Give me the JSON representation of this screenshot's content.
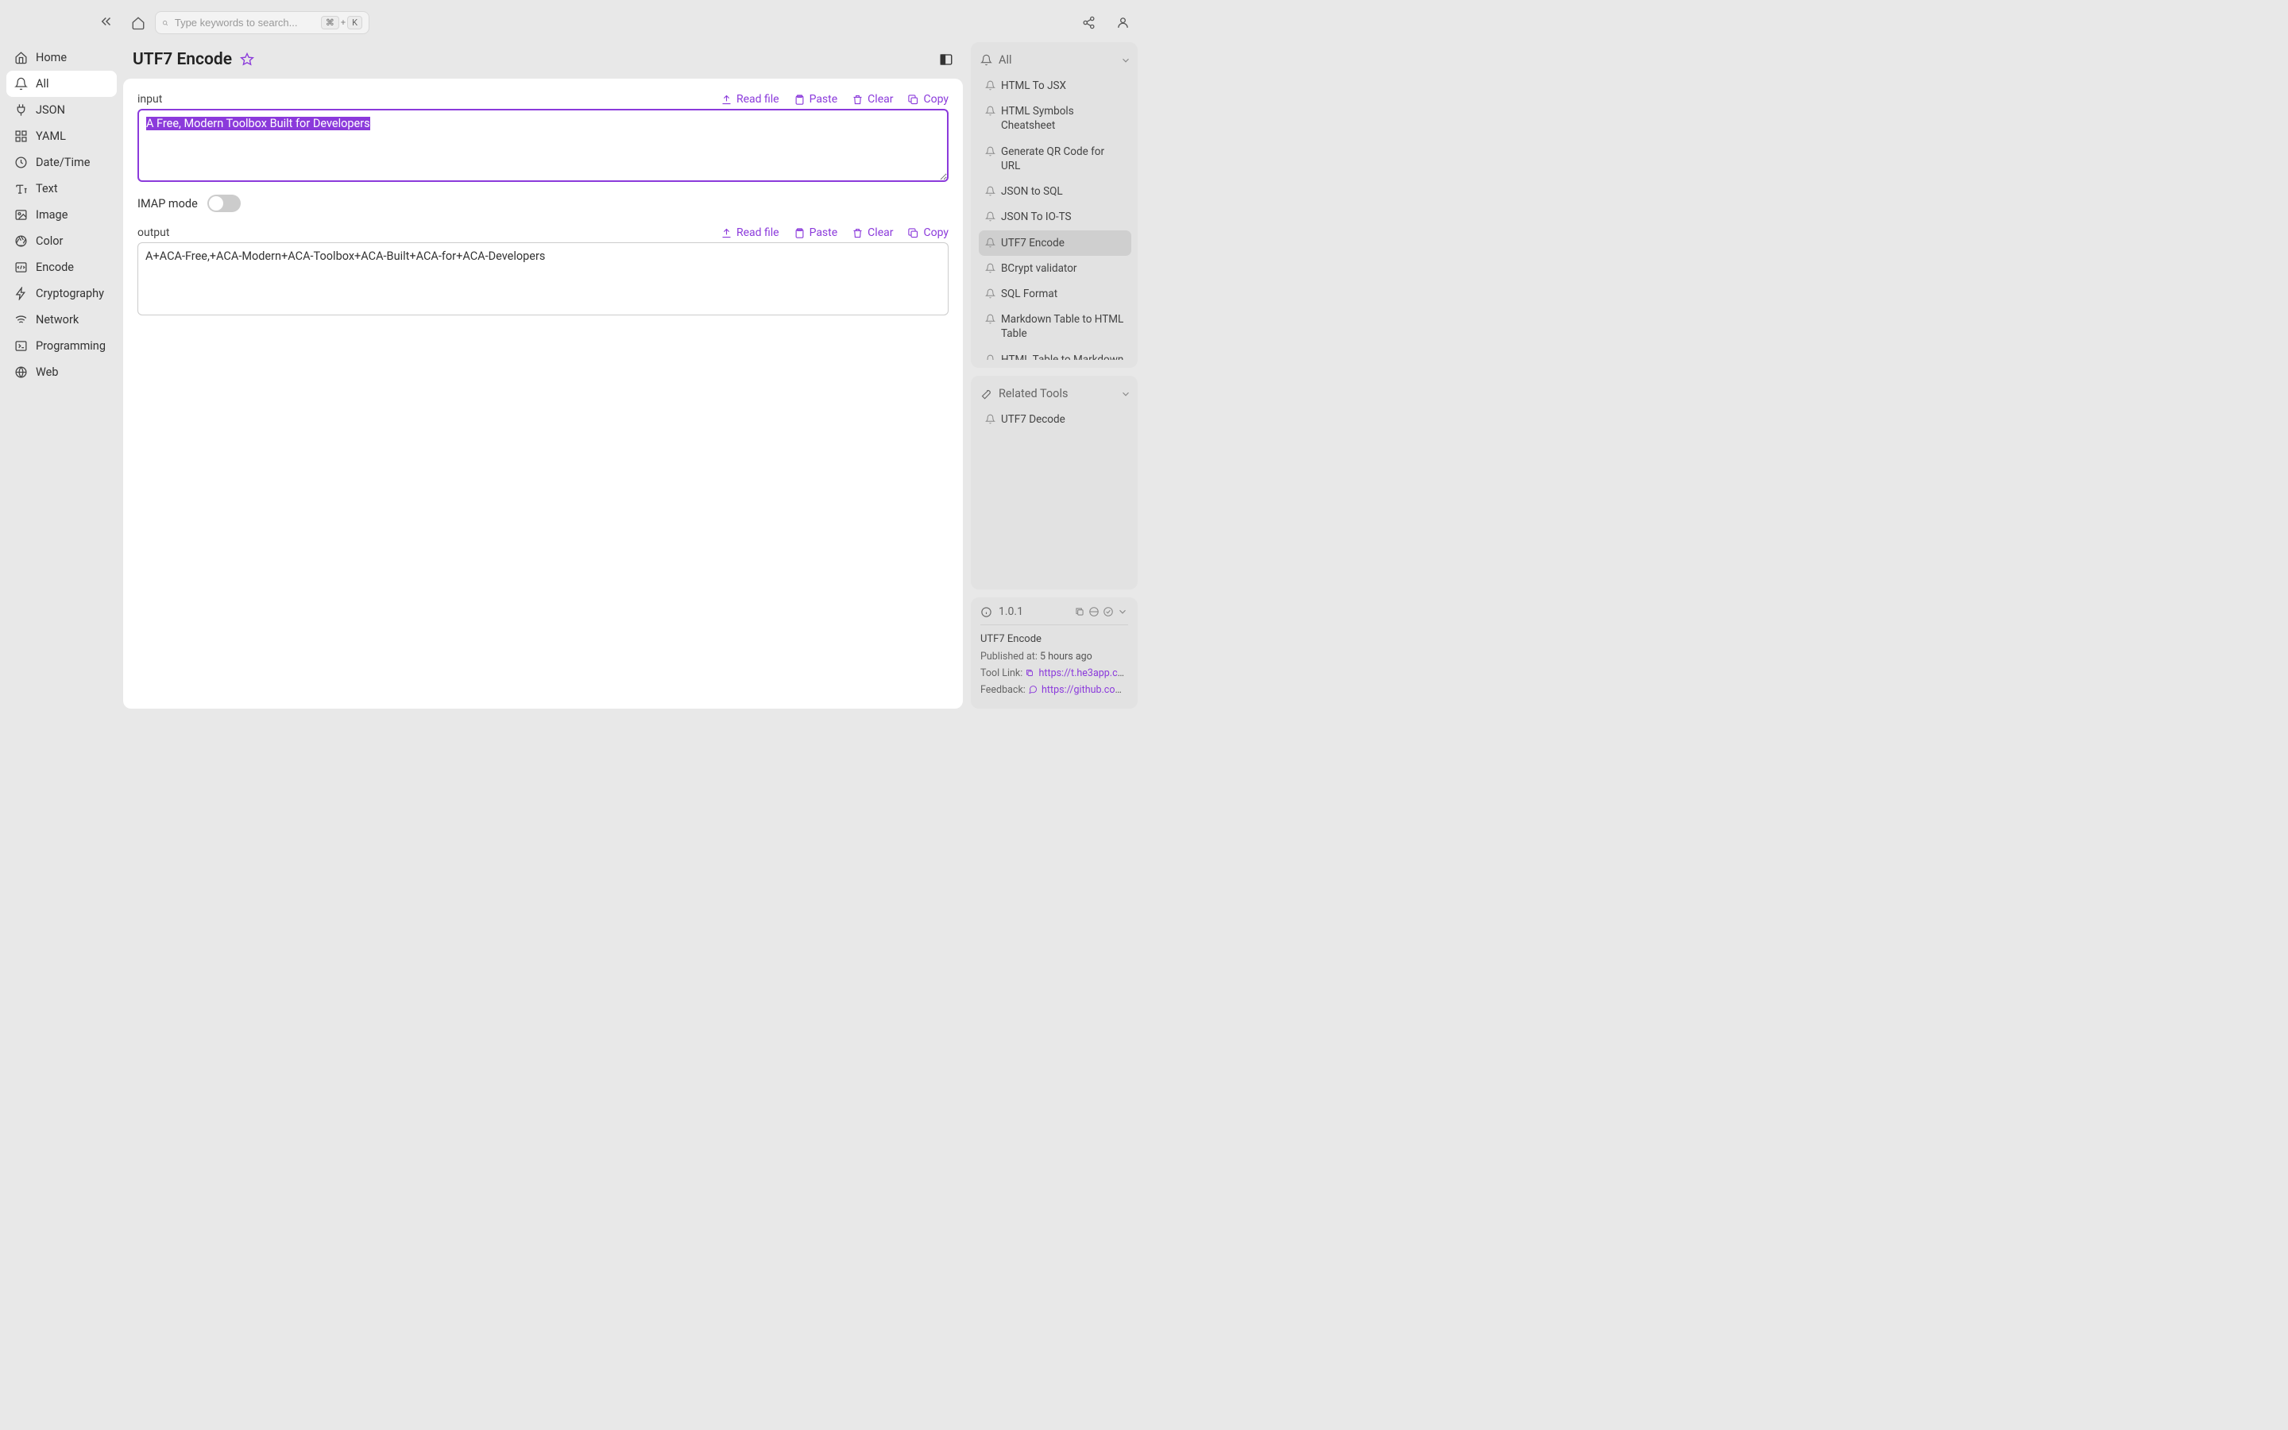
{
  "search": {
    "placeholder": "Type keywords to search...",
    "kbd_mod": "⌘",
    "kbd_plus": "+",
    "kbd_key": "K"
  },
  "sidebar": {
    "items": [
      {
        "label": "Home"
      },
      {
        "label": "All"
      },
      {
        "label": "JSON"
      },
      {
        "label": "YAML"
      },
      {
        "label": "Date/Time"
      },
      {
        "label": "Text"
      },
      {
        "label": "Image"
      },
      {
        "label": "Color"
      },
      {
        "label": "Encode"
      },
      {
        "label": "Cryptography"
      },
      {
        "label": "Network"
      },
      {
        "label": "Programming"
      },
      {
        "label": "Web"
      }
    ]
  },
  "page": {
    "title": "UTF7 Encode"
  },
  "input_section": {
    "label": "input",
    "value": "A Free, Modern Toolbox Built for Developers",
    "actions": {
      "read_file": "Read file",
      "paste": "Paste",
      "clear": "Clear",
      "copy": "Copy"
    }
  },
  "imap": {
    "label": "IMAP mode",
    "on": false
  },
  "output_section": {
    "label": "output",
    "value": "A+ACA-Free,+ACA-Modern+ACA-Toolbox+ACA-Built+ACA-for+ACA-Developers",
    "actions": {
      "read_file": "Read file",
      "paste": "Paste",
      "clear": "Clear",
      "copy": "Copy"
    }
  },
  "right": {
    "all_header": "All",
    "all_items": [
      "HTML To JSX",
      "HTML Symbols Cheatsheet",
      "Generate QR Code for URL",
      "JSON to SQL",
      "JSON To IO-TS",
      "UTF7 Encode",
      "BCrypt validator",
      "SQL Format",
      "Markdown Table to HTML Table",
      "HTML Table to Markdown Table"
    ],
    "all_active_index": 5,
    "related_header": "Related Tools",
    "related_items": [
      "UTF7 Decode"
    ]
  },
  "info": {
    "version": "1.0.1",
    "tool_name": "UTF7 Encode",
    "published_label": "Published at:",
    "published_value": "5 hours ago",
    "tool_link_label": "Tool Link:",
    "tool_link_value": "https://t.he3app.co…",
    "feedback_label": "Feedback:",
    "feedback_value": "https://github.com/…"
  }
}
